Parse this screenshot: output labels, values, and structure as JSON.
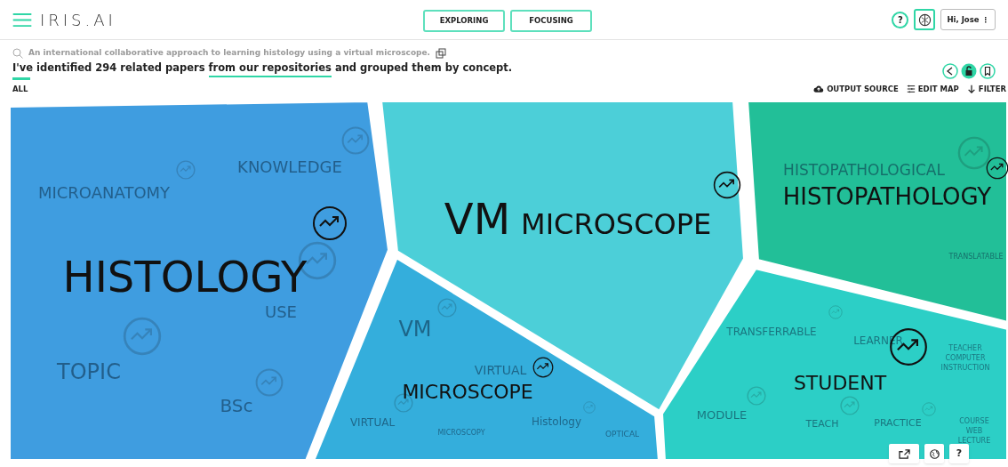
{
  "header": {
    "logo": "IRIS.AI",
    "modes": [
      "EXPLORING",
      "FOCUSING"
    ],
    "help": "?",
    "user": "Hi, Jose",
    "user_glyph": "⋮"
  },
  "query": "An international collaborative approach to learning histology using a virtual microscope.",
  "summary": {
    "before": "I've identified 294 related papers",
    "link": "from our repositories",
    "after": "and grouped them by concept."
  },
  "scope": "ALL",
  "actions": [
    {
      "kind": "cloud",
      "label": "OUTPUT SOURCE"
    },
    {
      "kind": "list",
      "label": "EDIT MAP"
    },
    {
      "kind": "down",
      "label": "FILTER"
    }
  ],
  "clusters": [
    {
      "label": "HISTOLOGY",
      "color": "#3f9de0",
      "subtopics": [
        "MICROANATOMY",
        "KNOWLEDGE",
        "USE",
        "TOPIC",
        "BSc"
      ]
    },
    {
      "lead": "VM",
      "label": "MICROSCOPE",
      "color": "#4ccfd8"
    },
    {
      "label": "HISTOPATHOLOGY",
      "color": "#22bf98",
      "subtopics": [
        "HISTOPATHOLOGICAL",
        "TRANSLATABLE"
      ]
    },
    {
      "label": "MICROSCOPE",
      "color": "#34aedc",
      "subtopics": [
        "VM",
        "VIRTUAL",
        "VIRTUAL",
        "MICROSCOPY",
        "Histology",
        "OPTICAL"
      ]
    },
    {
      "label": "STUDENT",
      "color": "#2ccfc6",
      "subtopics": [
        "TRANSFERRABLE",
        "LEARNER",
        "TEACHER COMPUTER INSTRUCTION",
        "MODULE",
        "TEACH",
        "PRACTICE",
        "COURSE WEB LECTURE"
      ]
    }
  ],
  "map_help": "?"
}
